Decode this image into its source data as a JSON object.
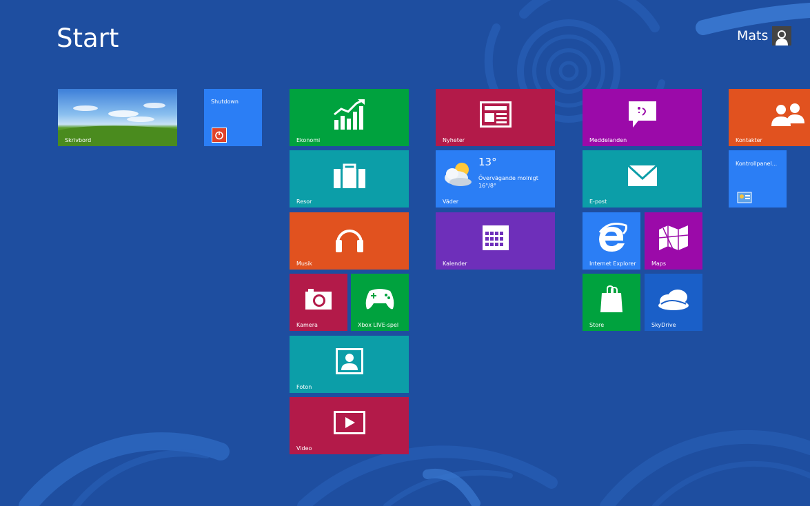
{
  "header": {
    "title": "Start",
    "user_name": "Mats"
  },
  "colors": {
    "background": "#1e4ea0",
    "green": "#00a23e",
    "teal": "#0c9ea8",
    "orange": "#e1521f",
    "crimson": "#b31a49",
    "purple": "#6e2fba",
    "magenta": "#9b0aa9",
    "blue": "#2b7ef5"
  },
  "tiles": {
    "desktop": {
      "label": "Skrivbord"
    },
    "shutdown": {
      "label": "Shutdown"
    },
    "finance": {
      "label": "Ekonomi",
      "icon": "chart-icon"
    },
    "travel": {
      "label": "Resor",
      "icon": "suitcase-icon"
    },
    "music": {
      "label": "Musik",
      "icon": "headphones-icon"
    },
    "camera": {
      "label": "Kamera",
      "icon": "camera-icon"
    },
    "xbox": {
      "label": "Xbox LIVE-spel",
      "icon": "gamepad-icon"
    },
    "photos": {
      "label": "Foton",
      "icon": "photo-icon"
    },
    "video": {
      "label": "Video",
      "icon": "play-icon"
    },
    "news": {
      "label": "Nyheter",
      "icon": "newspaper-icon"
    },
    "weather": {
      "label": "Väder",
      "temp": "13°",
      "condition": "Övervägande molnigt",
      "range": "16°/8°"
    },
    "calendar": {
      "label": "Kalender",
      "icon": "calendar-icon"
    },
    "messaging": {
      "label": "Meddelanden",
      "icon": "chat-icon"
    },
    "mail": {
      "label": "E-post",
      "icon": "mail-icon"
    },
    "ie": {
      "label": "Internet Explorer",
      "icon": "ie-icon"
    },
    "maps": {
      "label": "Maps",
      "icon": "map-icon"
    },
    "store": {
      "label": "Store",
      "icon": "bag-icon"
    },
    "skydrive": {
      "label": "SkyDrive",
      "icon": "cloud-icon"
    },
    "people": {
      "label": "Kontakter",
      "icon": "people-icon"
    },
    "control_panel": {
      "label": "Kontrollpanel..."
    }
  }
}
